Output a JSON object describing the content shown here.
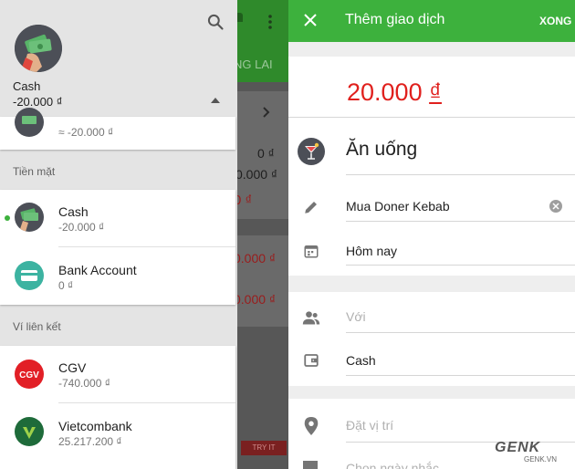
{
  "drawer": {
    "current_wallet": {
      "name": "Cash",
      "balance": "-20.000 ₫"
    },
    "partial_card_balance": "≈ -20.000 ₫",
    "section_cash": "Tiền mặt",
    "cash_wallets": [
      {
        "name": "Cash",
        "balance": "-20.000 ₫",
        "icon": "cash-money-icon",
        "active": true
      },
      {
        "name": "Bank Account",
        "balance": "0 ₫",
        "icon": "bank-card-icon",
        "active": false
      }
    ],
    "section_linked": "Ví liên kết",
    "linked_wallets": [
      {
        "name": "CGV",
        "balance": "-740.000 ₫",
        "icon": "cgv-logo-icon"
      },
      {
        "name": "Vietcombank",
        "balance": "25.217.200 ₫",
        "icon": "vietcombank-logo-icon"
      }
    ]
  },
  "background": {
    "tab_fragment": "NG LAI",
    "values": [
      "0 ₫",
      "0.000 ₫",
      "0 ₫",
      "0.000 ₫",
      "0.000 ₫"
    ],
    "try_button": "TRY IT"
  },
  "transaction": {
    "title": "Thêm giao dịch",
    "done_label": "XONG",
    "amount": "20.000",
    "currency": "₫",
    "category": "Ăn uống",
    "note": "Mua Doner Kebab",
    "date": "Hôm nay",
    "with_placeholder": "Với",
    "wallet": "Cash",
    "location_placeholder": "Đặt vị trí",
    "partial_field": "Chọn ngày nhắc"
  },
  "watermark": {
    "brand": "GENK",
    "site": "GENK.VN"
  },
  "colors": {
    "accent_green": "#3db13d",
    "amount_red": "#e0201d",
    "drawer_bg": "#e4e4e4"
  }
}
